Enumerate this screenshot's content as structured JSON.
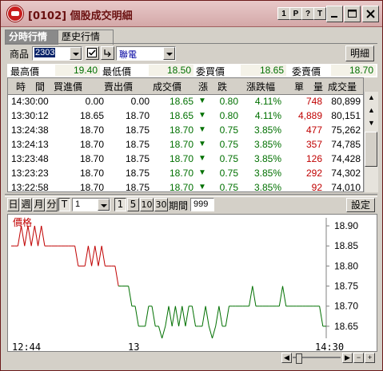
{
  "window": {
    "title": "[0102] 個股成交明細"
  },
  "title_buttons": [
    "1",
    "P",
    "?",
    "T"
  ],
  "tabs": [
    "分時行情",
    "歷史行情"
  ],
  "selector": {
    "product_label": "商品",
    "code": "2303",
    "name": "聯電",
    "detail_button": "明細"
  },
  "summary": [
    {
      "label": "最高價",
      "value": "19.40"
    },
    {
      "label": "最低價",
      "value": "18.50"
    },
    {
      "label": "委買價",
      "value": "18.65"
    },
    {
      "label": "委賣價",
      "value": "18.70"
    }
  ],
  "table": {
    "headers": [
      "時　間",
      "買進價",
      "賣出價",
      "成交價",
      "漲　跌",
      "漲跌幅",
      "單　量",
      "成交量"
    ],
    "rows": [
      [
        "14:30:00",
        "0.00",
        "0.00",
        "18.65",
        "0.80",
        "4.11%",
        "748",
        "80,899"
      ],
      [
        "13:30:12",
        "18.65",
        "18.70",
        "18.65",
        "0.80",
        "4.11%",
        "4,889",
        "80,151"
      ],
      [
        "13:24:38",
        "18.70",
        "18.75",
        "18.70",
        "0.75",
        "3.85%",
        "477",
        "75,262"
      ],
      [
        "13:24:13",
        "18.70",
        "18.75",
        "18.70",
        "0.75",
        "3.85%",
        "357",
        "74,785"
      ],
      [
        "13:23:48",
        "18.70",
        "18.75",
        "18.70",
        "0.75",
        "3.85%",
        "126",
        "74,428"
      ],
      [
        "13:23:23",
        "18.70",
        "18.75",
        "18.70",
        "0.75",
        "3.85%",
        "292",
        "74,302"
      ],
      [
        "13:22:58",
        "18.70",
        "18.75",
        "18.70",
        "0.75",
        "3.85%",
        "92",
        "74,010"
      ]
    ],
    "down_arrow": "▼",
    "colors": {
      "up": "#007000",
      "down": "#007000",
      "volume_red": "#c00000"
    }
  },
  "period_toolbar": {
    "buttons": [
      "日",
      "週",
      "月",
      "分",
      "T"
    ],
    "interval": "1",
    "minutes": [
      "1",
      "5",
      "10",
      "30"
    ],
    "period_label": "期間",
    "period_value": "999",
    "settings_button": "設定"
  },
  "chart_data": {
    "type": "line",
    "title": "價格",
    "x": [
      "12:44",
      "13",
      "14:30"
    ],
    "y_ticks": [
      18.9,
      18.85,
      18.8,
      18.75,
      18.7,
      18.65
    ],
    "ylim": [
      18.62,
      18.92
    ],
    "series": [
      {
        "values": [
          18.85,
          18.85,
          18.85,
          18.9,
          18.85,
          18.9,
          18.85,
          18.9,
          18.85,
          18.9,
          18.85,
          18.85,
          18.85,
          18.85,
          18.85,
          18.85,
          18.85,
          18.85,
          18.85,
          18.85,
          18.8,
          18.8,
          18.8,
          18.85,
          18.8,
          18.85,
          18.8,
          18.85,
          18.8,
          18.8,
          18.8,
          18.8,
          18.75,
          18.75,
          18.75,
          18.75,
          18.7,
          18.7,
          18.65,
          18.65,
          18.65,
          18.7,
          18.7,
          18.65,
          18.65,
          18.62,
          18.65,
          18.7,
          18.65,
          18.7,
          18.65,
          18.7,
          18.65,
          18.7,
          18.7,
          18.65,
          18.65,
          18.65,
          18.7,
          18.65,
          18.62,
          18.65,
          18.7,
          18.65,
          18.65,
          18.7,
          18.7,
          18.7,
          18.7,
          18.7,
          18.7,
          18.7,
          18.75,
          18.7,
          18.7,
          18.7,
          18.7,
          18.7,
          18.7,
          18.7,
          18.7,
          18.75,
          18.7,
          18.7,
          18.7,
          18.7,
          18.7,
          18.7,
          18.7,
          18.7,
          18.7,
          18.7,
          18.7,
          18.65,
          18.65
        ]
      }
    ]
  }
}
